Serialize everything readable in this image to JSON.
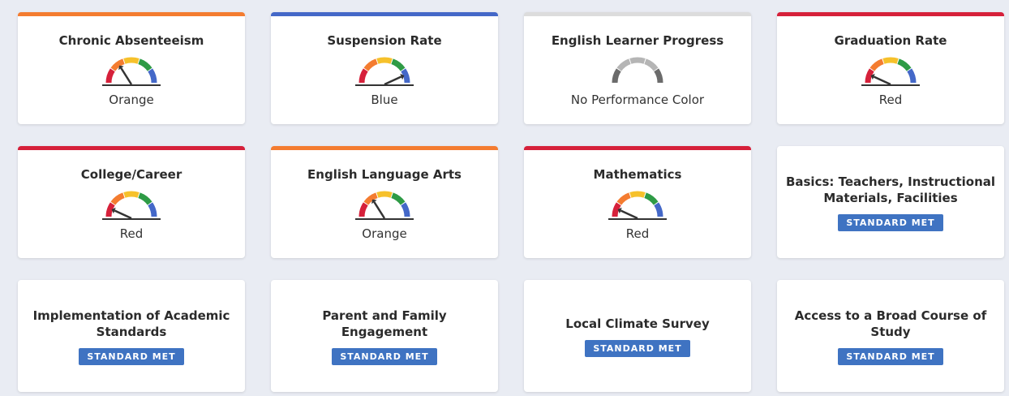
{
  "cards": [
    {
      "title": "Chronic Absenteeism",
      "status": "Orange",
      "level": "orange",
      "bar_color": "#f47c30"
    },
    {
      "title": "Suspension Rate",
      "status": "Blue",
      "level": "blue",
      "bar_color": "#4468c8"
    },
    {
      "title": "English Learner Progress",
      "status": "No Performance Color",
      "level": "none",
      "bar_color": "#dcdcdc"
    },
    {
      "title": "Graduation Rate",
      "status": "Red",
      "level": "red",
      "bar_color": "#d6203a"
    },
    {
      "title": "College/Career",
      "status": "Red",
      "level": "red",
      "bar_color": "#d6203a"
    },
    {
      "title": "English Language Arts",
      "status": "Orange",
      "level": "orange",
      "bar_color": "#f47c30"
    },
    {
      "title": "Mathematics",
      "status": "Red",
      "level": "red",
      "bar_color": "#d6203a"
    },
    {
      "title": "Basics: Teachers, Instructional Materials, Facilities",
      "badge": "STANDARD MET"
    },
    {
      "title": "Implementation of Academic Standards",
      "badge": "STANDARD MET"
    },
    {
      "title": "Parent and Family Engagement",
      "badge": "STANDARD MET"
    },
    {
      "title": "Local Climate Survey",
      "badge": "STANDARD MET"
    },
    {
      "title": "Access to a Broad Course of Study",
      "badge": "STANDARD MET"
    }
  ],
  "gauge_colors": {
    "red": "#d6203a",
    "orange": "#f47c30",
    "yellow": "#f6c12b",
    "green": "#2e9b45",
    "blue": "#4468c8",
    "gray_light": "#b5b5b5",
    "gray_dark": "#6b6b6b"
  }
}
